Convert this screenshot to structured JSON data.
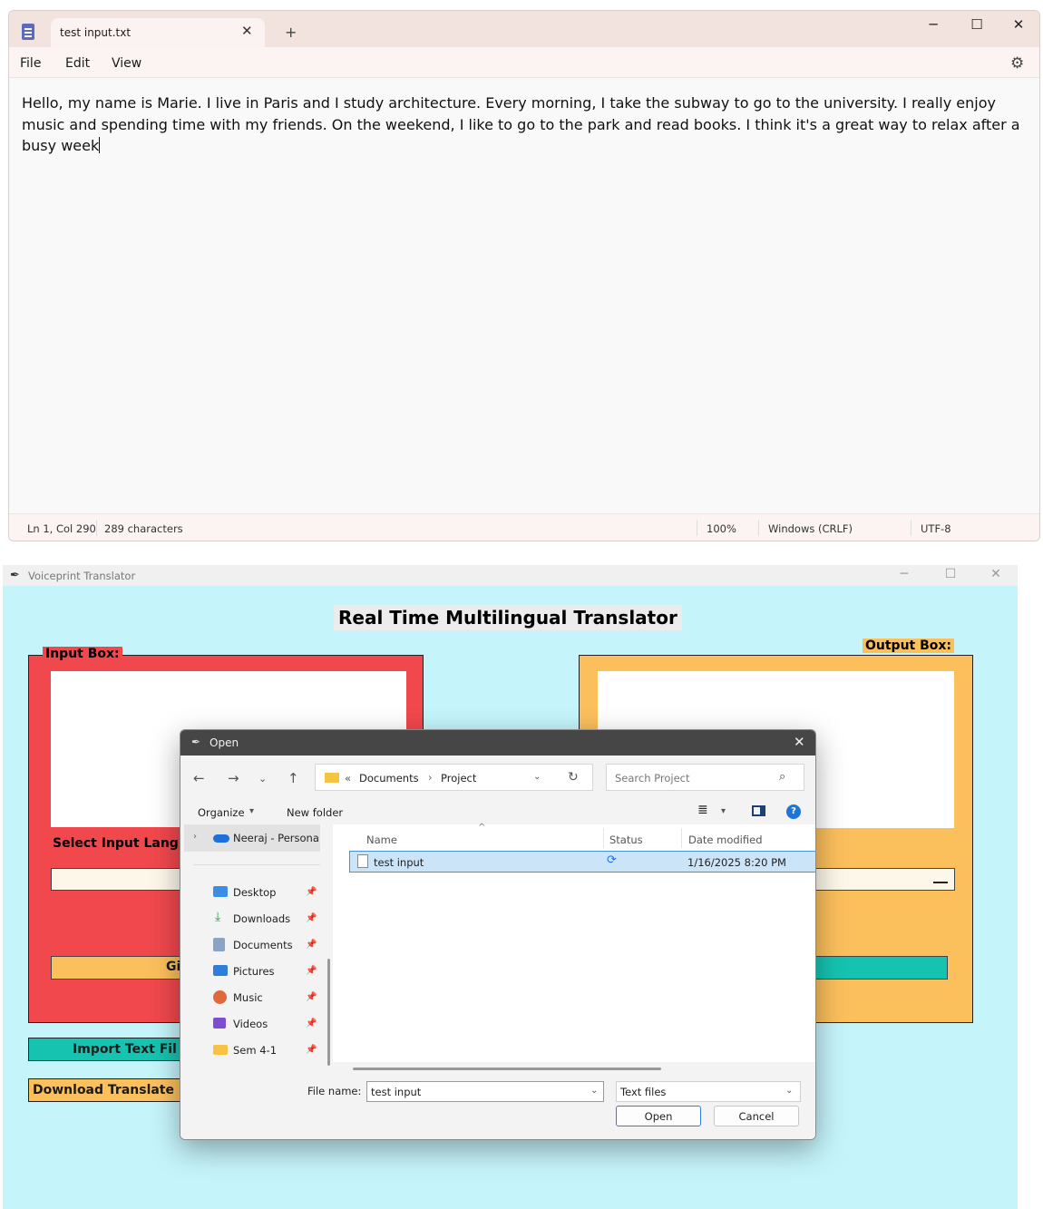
{
  "notepad": {
    "tab_title": "test input.txt",
    "new_tab": "+",
    "controls": {
      "minimize": "─",
      "maximize": "☐",
      "close": "✕"
    },
    "menu": [
      "File",
      "Edit",
      "View"
    ],
    "content": "Hello, my name is Marie. I live in Paris and I study architecture. Every morning, I take the subway to go to the university. I really enjoy music and spending time with my friends. On the weekend, I like to go to the park and read books. I think it's a great way to relax after a busy week",
    "status": {
      "position": "Ln 1, Col 290",
      "characters": "289 characters",
      "zoom": "100%",
      "line_endings": "Windows (CRLF)",
      "encoding": "UTF-8"
    }
  },
  "app": {
    "window_title": "Voiceprint Translator",
    "heading": "Real Time Multilingual Translator",
    "input_box_label": "Input Box:",
    "output_box_label": "Output Box:",
    "select_input_language": "Select Input Lang",
    "input_button_partial": "Gi",
    "import_button": "Import Text Fil",
    "download_button": "Download Translate"
  },
  "dialog": {
    "title": "Open",
    "breadcrumb": {
      "chevrons": "«",
      "parts": [
        "Documents",
        "Project"
      ]
    },
    "search_placeholder": "Search Project",
    "organize": "Organize",
    "new_folder": "New folder",
    "help": "?",
    "sidebar": {
      "onedrive": "Neeraj - Persona",
      "items": [
        {
          "label": "Desktop",
          "icon": "desktop-icon",
          "color": "#3a8ee6"
        },
        {
          "label": "Downloads",
          "icon": "download-icon",
          "color": "#2e9c4f"
        },
        {
          "label": "Documents",
          "icon": "documents-icon",
          "color": "#8aa2c8"
        },
        {
          "label": "Pictures",
          "icon": "pictures-icon",
          "color": "#2f7ed8"
        },
        {
          "label": "Music",
          "icon": "music-icon",
          "color": "#e2673a"
        },
        {
          "label": "Videos",
          "icon": "videos-icon",
          "color": "#7b4fd0"
        },
        {
          "label": "Sem 4-1",
          "icon": "folder-icon",
          "color": "#f6c342"
        }
      ]
    },
    "columns": {
      "name": "Name",
      "status": "Status",
      "date": "Date modified"
    },
    "files": [
      {
        "name": "test input",
        "status_icon": "sync-icon",
        "date": "1/16/2025 8:20 PM"
      }
    ],
    "file_name_label": "File name:",
    "file_name_value": "test input",
    "file_type": "Text files",
    "open_button": "Open",
    "cancel_button": "Cancel"
  }
}
